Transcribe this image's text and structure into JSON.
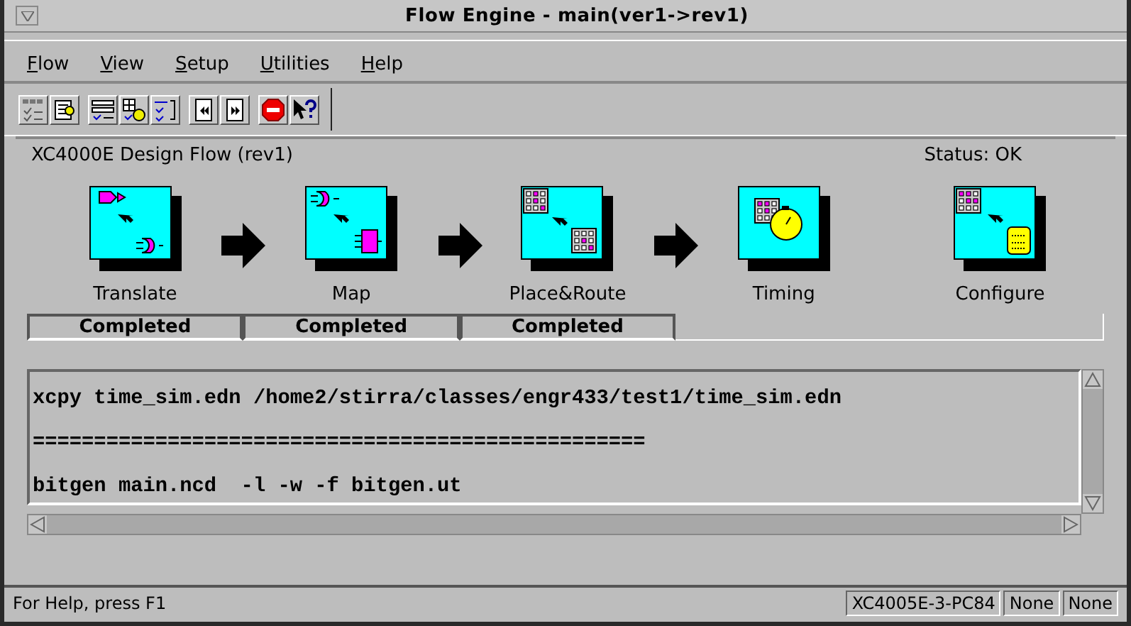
{
  "window": {
    "title": "Flow Engine - main(ver1->rev1)"
  },
  "menu": [
    {
      "mnemonic": "F",
      "rest": "low"
    },
    {
      "mnemonic": "V",
      "rest": "iew"
    },
    {
      "mnemonic": "S",
      "rest": "etup"
    },
    {
      "mnemonic": "U",
      "rest": "tilities"
    },
    {
      "mnemonic": "H",
      "rest": "elp"
    }
  ],
  "flow": {
    "title": "XC4000E Design Flow (rev1)",
    "status": "Status: OK",
    "stages": [
      {
        "kind": "translate",
        "label": "Translate",
        "status": "Completed",
        "arrow_after": true
      },
      {
        "kind": "map",
        "label": "Map",
        "status": "Completed",
        "arrow_after": true
      },
      {
        "kind": "place_route",
        "label": "Place&Route",
        "status": "Completed",
        "arrow_after": true
      },
      {
        "kind": "timing",
        "label": "Timing",
        "arrow_after": false
      },
      {
        "kind": "configure",
        "label": "Configure",
        "arrow_after": false
      }
    ]
  },
  "log": {
    "lines": [
      "xcpy time_sim.edn /home2/stirra/classes/engr433/test1/time_sim.edn",
      "==================================================",
      "bitgen main.ncd  -l -w -f bitgen.ut"
    ]
  },
  "status_bar": {
    "help": "For Help, press F1",
    "panes": [
      "XC4005E-3-PC84",
      "None",
      "None"
    ]
  }
}
